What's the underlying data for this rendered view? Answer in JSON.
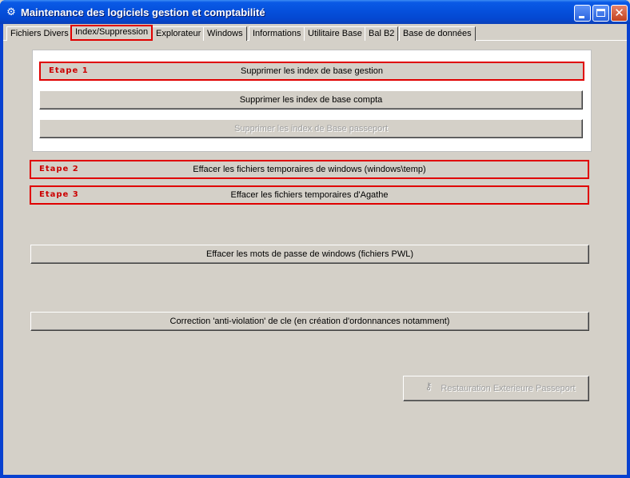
{
  "window": {
    "title": "Maintenance des logiciels gestion et comptabilité",
    "minimize_label": "",
    "maximize_label": "",
    "close_glyph": "✕"
  },
  "tabs": [
    {
      "label": "Fichiers Divers"
    },
    {
      "label": "Index/Suppression",
      "active": true
    },
    {
      "label": "Explorateur"
    },
    {
      "label": "Windows"
    },
    {
      "label": "Informations"
    },
    {
      "label": "Utilitaire Base"
    },
    {
      "label": "Bal B2"
    },
    {
      "label": "Base de données"
    }
  ],
  "index_group": {
    "btn_gestion": {
      "label": "Supprimer les index de base gestion",
      "step": "Etape 1"
    },
    "btn_compta": {
      "label": "Supprimer les index de base compta"
    },
    "btn_passeport": {
      "label": "Supprimer les index de Base passeport",
      "disabled": true
    }
  },
  "btn_temp_windows": {
    "label": "Effacer les fichiers temporaires de windows (windows\\temp)",
    "step": "Etape 2"
  },
  "btn_temp_agathe": {
    "label": "Effacer les fichiers temporaires d'Agathe",
    "step": "Etape 3"
  },
  "btn_pwl": {
    "label": "Effacer les mots de passe de windows (fichiers PWL)"
  },
  "btn_anti_violation": {
    "label": "Correction 'anti-violation' de cle (en création d'ordonnances notamment)"
  },
  "btn_restauration": {
    "label": "Restauration Exterieure Passeport",
    "icon": "key-icon",
    "disabled": true
  },
  "colors": {
    "highlight": "#e00000",
    "face": "#d4d0c8",
    "titlebar": "#0550dc"
  }
}
